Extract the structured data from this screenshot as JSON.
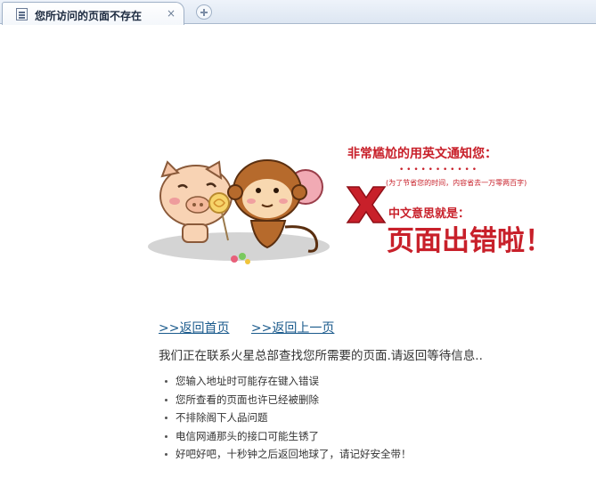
{
  "tab": {
    "title": "您所访问的页面不存在",
    "close_symbol": "×"
  },
  "illustration": {
    "heading": "非常尴尬的用英文通知您：",
    "dots": "• • • • • • • • • • •",
    "note": "(为了节省您的时间，内容省去一万零两百字)",
    "subheading": "中文意思就是：",
    "main_text": "页面出错啦！",
    "accent_color": "#c8202a"
  },
  "links": {
    "home": ">>返回首页",
    "back": ">>返回上一页"
  },
  "message": "我们正在联系火星总部查找您所需要的页面.请返回等待信息..",
  "reasons": [
    "您输入地址时可能存在键入错误",
    "您所查看的页面也许已经被删除",
    "不排除阁下人品问题",
    "电信网通那头的接口可能生锈了",
    "好吧好吧，十秒钟之后返回地球了，请记好安全带！"
  ]
}
